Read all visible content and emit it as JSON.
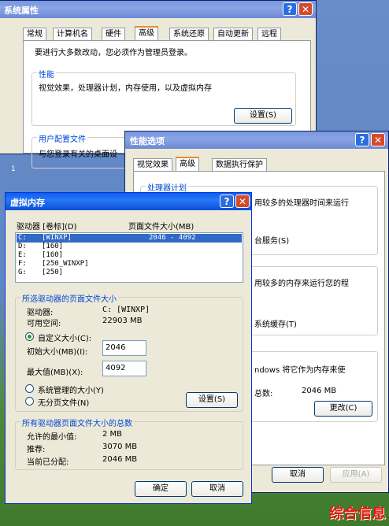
{
  "sys_props": {
    "title": "系统属性",
    "tabs": [
      "常规",
      "计算机名",
      "硬件",
      "高级",
      "系统还原",
      "自动更新",
      "远程"
    ],
    "admin_note": "要进行大多数改动，您必须作为管理员登录。",
    "perf_label": "性能",
    "perf_desc": "视觉效果，处理器计划，内存使用，以及虚拟内存",
    "settings_btn": "设置(S)",
    "profile_label": "用户配置文件",
    "profile_desc": "与您登录有关的桌面设"
  },
  "perf_opts": {
    "title": "性能选项",
    "tabs": [
      "视觉效果",
      "高级",
      "数据执行保护"
    ],
    "cpu_label": "处理器计划",
    "cpu_desc": "用较多的处理器时间来运行",
    "bg_service": "台服务(S)",
    "mem_desc": "用较多的内存来运行您的程",
    "sys_cache": "系统缓存(T)",
    "vm_desc": "ndows 将它作为内存来使",
    "total_label": "总数:",
    "total_value": "2046 MB",
    "change_btn": "更改(C)",
    "cancel_btn": "取消",
    "apply_btn": "应用(A)"
  },
  "vmem": {
    "title": "虚拟内存",
    "col_drive": "驱动器 [卷标](D)",
    "col_size": "页面文件大小(MB)",
    "drives": [
      {
        "drive": "C:",
        "label": "[WINXP]",
        "size": "2046 - 4092"
      },
      {
        "drive": "D:",
        "label": "[160]",
        "size": ""
      },
      {
        "drive": "E:",
        "label": "[160]",
        "size": ""
      },
      {
        "drive": "F:",
        "label": "[250_WINXP]",
        "size": ""
      },
      {
        "drive": "G:",
        "label": "[250]",
        "size": ""
      }
    ],
    "selected_group": "所选驱动器的页面文件大小",
    "drive_label": "驱动器:",
    "drive_value": "C:  [WINXP]",
    "space_label": "可用空间:",
    "space_value": "22903 MB",
    "custom_size": "自定义大小(C):",
    "initial_label": "初始大小(MB)(I):",
    "initial_value": "2046",
    "max_label": "最大值(MB)(X):",
    "max_value": "4092",
    "system_managed": "系统管理的大小(Y)",
    "no_paging": "无分页文件(N)",
    "set_btn": "设置(S)",
    "total_group": "所有驱动器页面文件大小的总数",
    "min_label": "允许的最小值:",
    "min_value": "2 MB",
    "rec_label": "推荐:",
    "rec_value": "3070 MB",
    "cur_label": "当前已分配:",
    "cur_value": "2046 MB",
    "ok_btn": "确定",
    "cancel_btn": "取消"
  },
  "watermark": "综合信息",
  "desktop_marker": "1"
}
